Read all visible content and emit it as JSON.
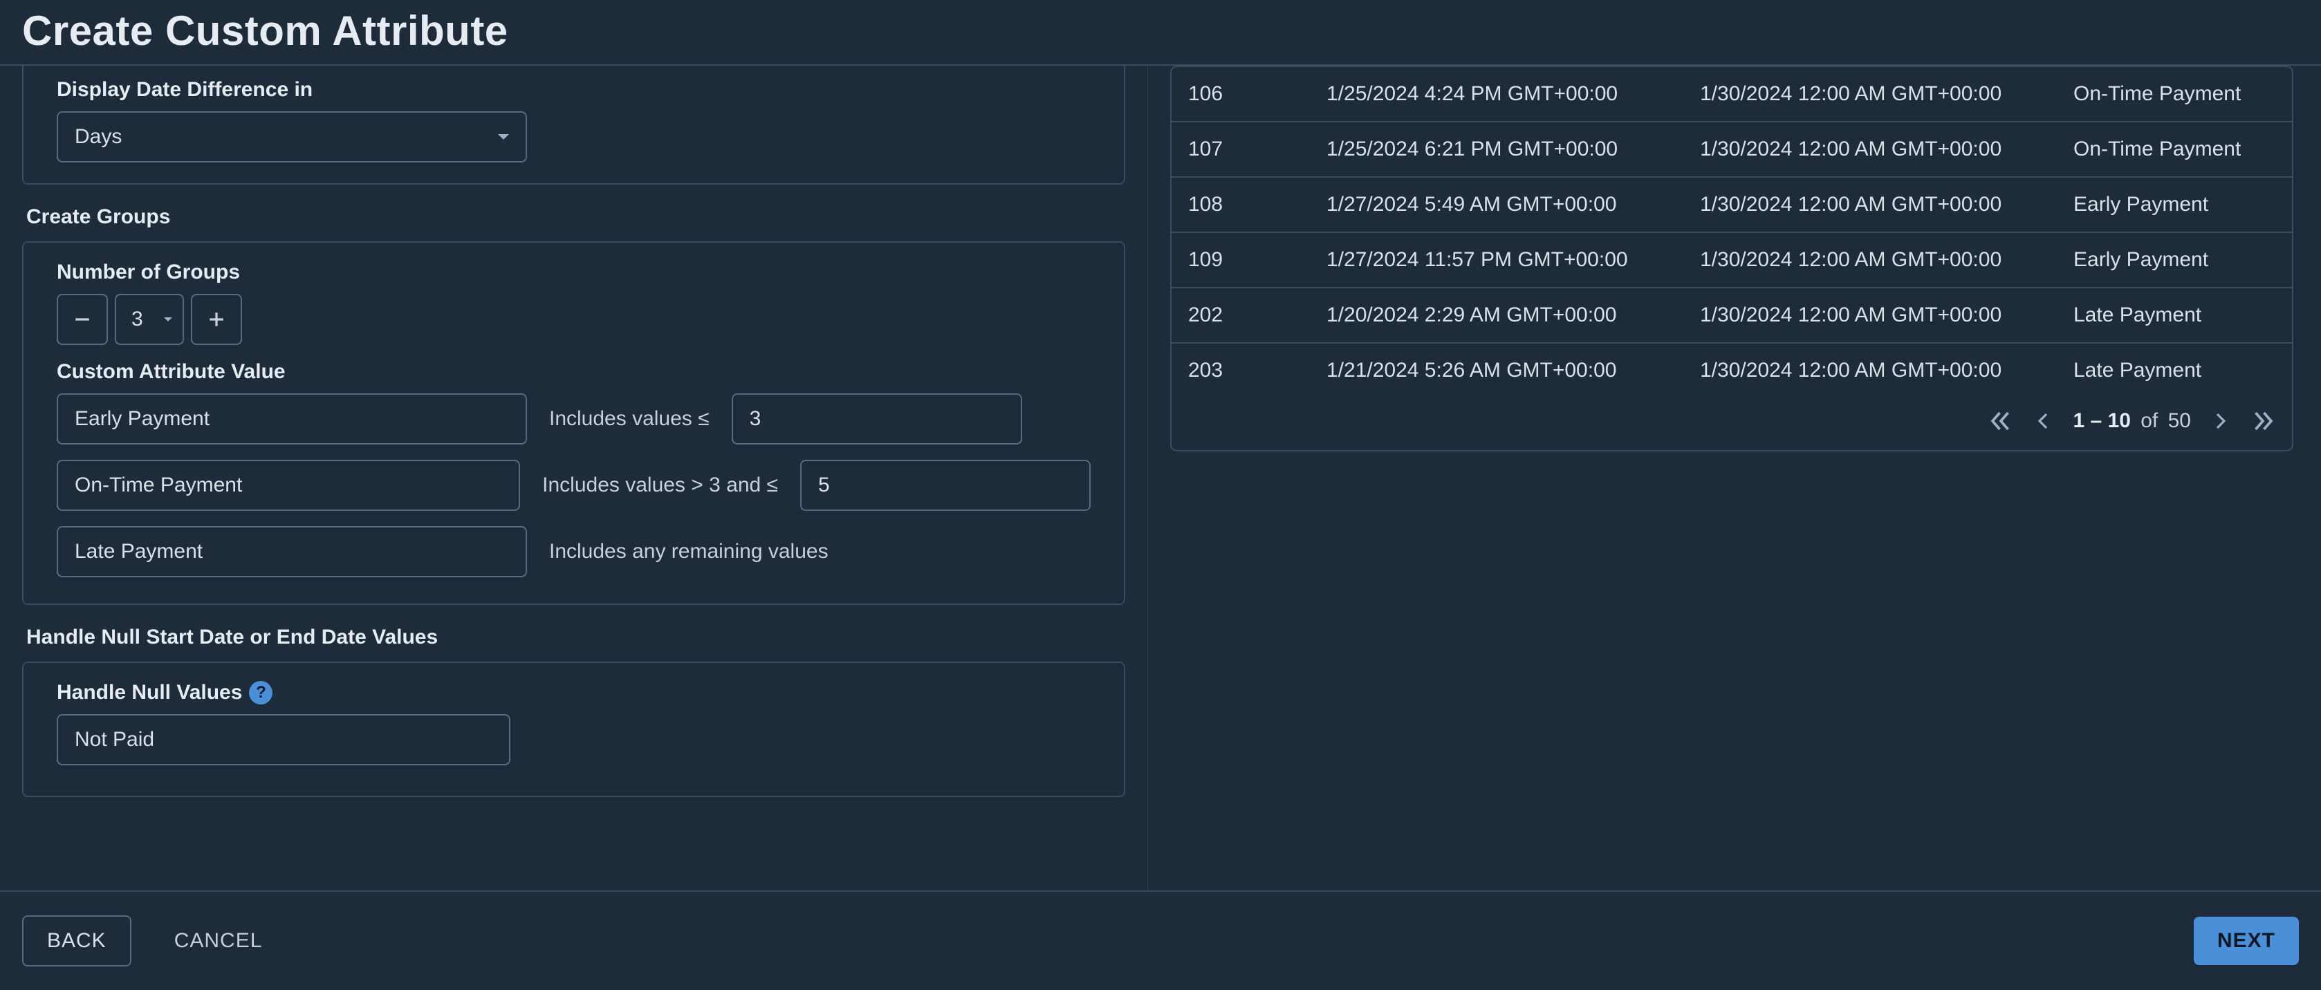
{
  "header": {
    "title": "Create Custom Attribute"
  },
  "display_diff": {
    "label": "Display Date Difference in",
    "value": "Days"
  },
  "create_groups": {
    "heading": "Create Groups",
    "num_groups_label": "Number of Groups",
    "num_groups_value": "3",
    "custom_value_label": "Custom Attribute Value",
    "rows": [
      {
        "value": "Early Payment",
        "cond_prefix": "Includes values ≤",
        "threshold": "3"
      },
      {
        "value": "On-Time Payment",
        "cond_prefix": "Includes values > 3 and ≤",
        "threshold": "5"
      },
      {
        "value": "Late Payment",
        "cond_prefix": "Includes any remaining values",
        "threshold": null
      }
    ]
  },
  "null_section": {
    "heading": "Handle Null Start Date or End Date Values",
    "field_label": "Handle Null Values",
    "value": "Not Paid"
  },
  "table": {
    "rows": [
      {
        "id": "106",
        "start": "1/25/2024 4:24 PM GMT+00:00",
        "end": "1/30/2024 12:00 AM GMT+00:00",
        "result": "On-Time Payment"
      },
      {
        "id": "107",
        "start": "1/25/2024 6:21 PM GMT+00:00",
        "end": "1/30/2024 12:00 AM GMT+00:00",
        "result": "On-Time Payment"
      },
      {
        "id": "108",
        "start": "1/27/2024 5:49 AM GMT+00:00",
        "end": "1/30/2024 12:00 AM GMT+00:00",
        "result": "Early Payment"
      },
      {
        "id": "109",
        "start": "1/27/2024 11:57 PM GMT+00:00",
        "end": "1/30/2024 12:00 AM GMT+00:00",
        "result": "Early Payment"
      },
      {
        "id": "202",
        "start": "1/20/2024 2:29 AM GMT+00:00",
        "end": "1/30/2024 12:00 AM GMT+00:00",
        "result": "Late Payment"
      },
      {
        "id": "203",
        "start": "1/21/2024 5:26 AM GMT+00:00",
        "end": "1/30/2024 12:00 AM GMT+00:00",
        "result": "Late Payment"
      }
    ],
    "pager": {
      "range": "1 – 10",
      "of_word": "of",
      "total": "50"
    }
  },
  "footer": {
    "back": "BACK",
    "cancel": "CANCEL",
    "next": "NEXT"
  }
}
